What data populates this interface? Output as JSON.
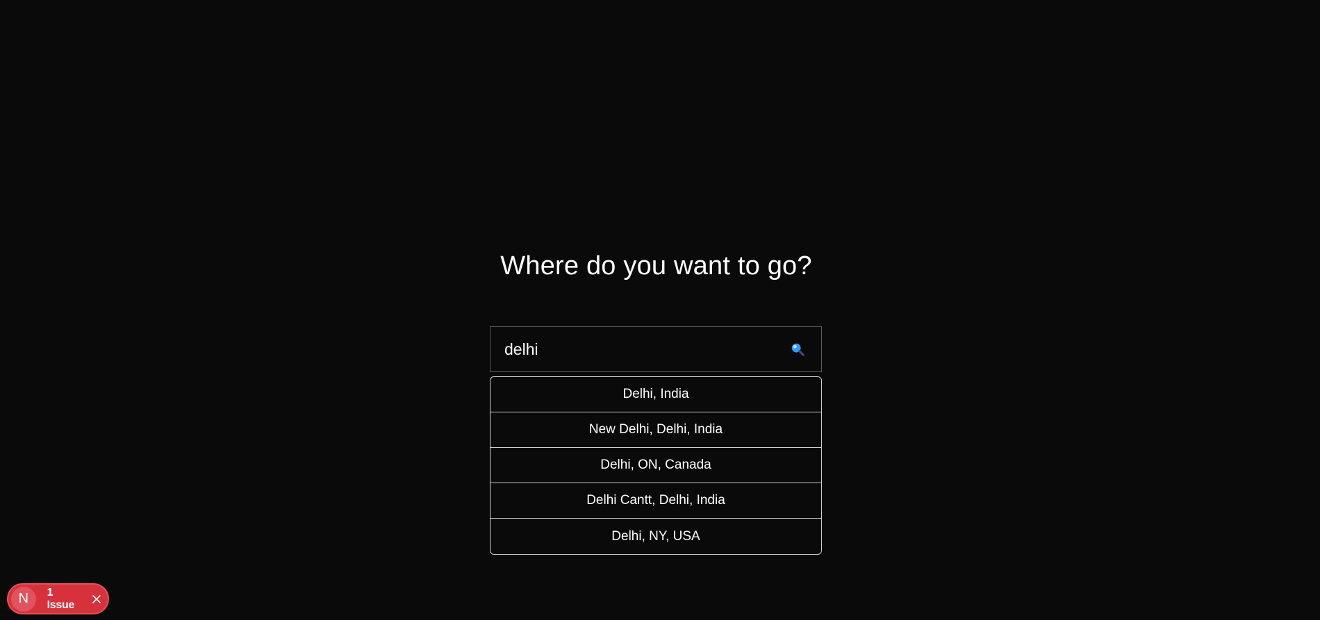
{
  "main": {
    "heading": "Where do you want to go?"
  },
  "search": {
    "value": "delhi",
    "placeholder": "",
    "icon": "magnifying-glass-icon"
  },
  "suggestions": [
    {
      "label": "Delhi, India"
    },
    {
      "label": "New Delhi, Delhi, India"
    },
    {
      "label": "Delhi, ON, Canada"
    },
    {
      "label": "Delhi Cantt, Delhi, India"
    },
    {
      "label": "Delhi, NY, USA"
    }
  ],
  "dev_overlay": {
    "logo_letter": "N",
    "issues_label": "1 Issue",
    "close_icon": "close-icon"
  },
  "colors": {
    "background": "#0a0a0a",
    "text": "#ffffff",
    "issue_badge": "#d7323c",
    "search_icon_accent": "#1e90ff"
  }
}
